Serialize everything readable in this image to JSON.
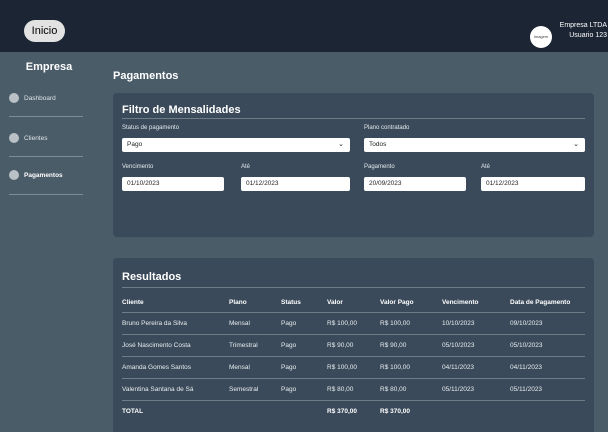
{
  "header": {
    "home_label": "Inicio",
    "company_logo_text": "Imagem",
    "company_name": "Empresa LTDA",
    "user_name": "Usuario 123"
  },
  "sidebar": {
    "title": "Empresa",
    "items": [
      {
        "label": "Dashboard",
        "active": false
      },
      {
        "label": "Clientes",
        "active": false
      },
      {
        "label": "Pagamentos",
        "active": true
      }
    ]
  },
  "main": {
    "title": "Pagamentos",
    "filter": {
      "title": "Filtro de Mensalidades",
      "status_label": "Status de pagamento",
      "status_value": "Pago",
      "plan_label": "Plano contratado",
      "plan_value": "Todos",
      "due_label": "Vencimento",
      "due_from": "01/10/2023",
      "due_to_label": "Até",
      "due_to": "01/12/2023",
      "payment_label": "Pagamento",
      "payment_from": "20/09/2023",
      "payment_to_label": "Até",
      "payment_to": "01/12/2023"
    },
    "results": {
      "title": "Resultados",
      "columns": [
        "Cliente",
        "Plano",
        "Status",
        "Valor",
        "Valor Pago",
        "Vencimento",
        "Data de Pagamento"
      ],
      "rows": [
        [
          "Bruno Pereira da Silva",
          "Mensal",
          "Pago",
          "R$ 100,00",
          "R$ 100,00",
          "10/10/2023",
          "09/10/2023"
        ],
        [
          "José Nascimento Costa",
          "Trimestral",
          "Pago",
          "R$ 90,00",
          "R$ 90,00",
          "05/10/2023",
          "05/10/2023"
        ],
        [
          "Amanda Gomes Santos",
          "Mensal",
          "Pago",
          "R$ 100,00",
          "R$ 100,00",
          "04/11/2023",
          "04/11/2023"
        ],
        [
          "Valentina Santana de Sá",
          "Semestral",
          "Pago",
          "R$ 80,00",
          "R$ 80,00",
          "05/11/2023",
          "05/11/2023"
        ]
      ],
      "total": [
        "TOTAL",
        "",
        "",
        "R$ 370,00",
        "R$ 370,00",
        "",
        ""
      ]
    }
  }
}
